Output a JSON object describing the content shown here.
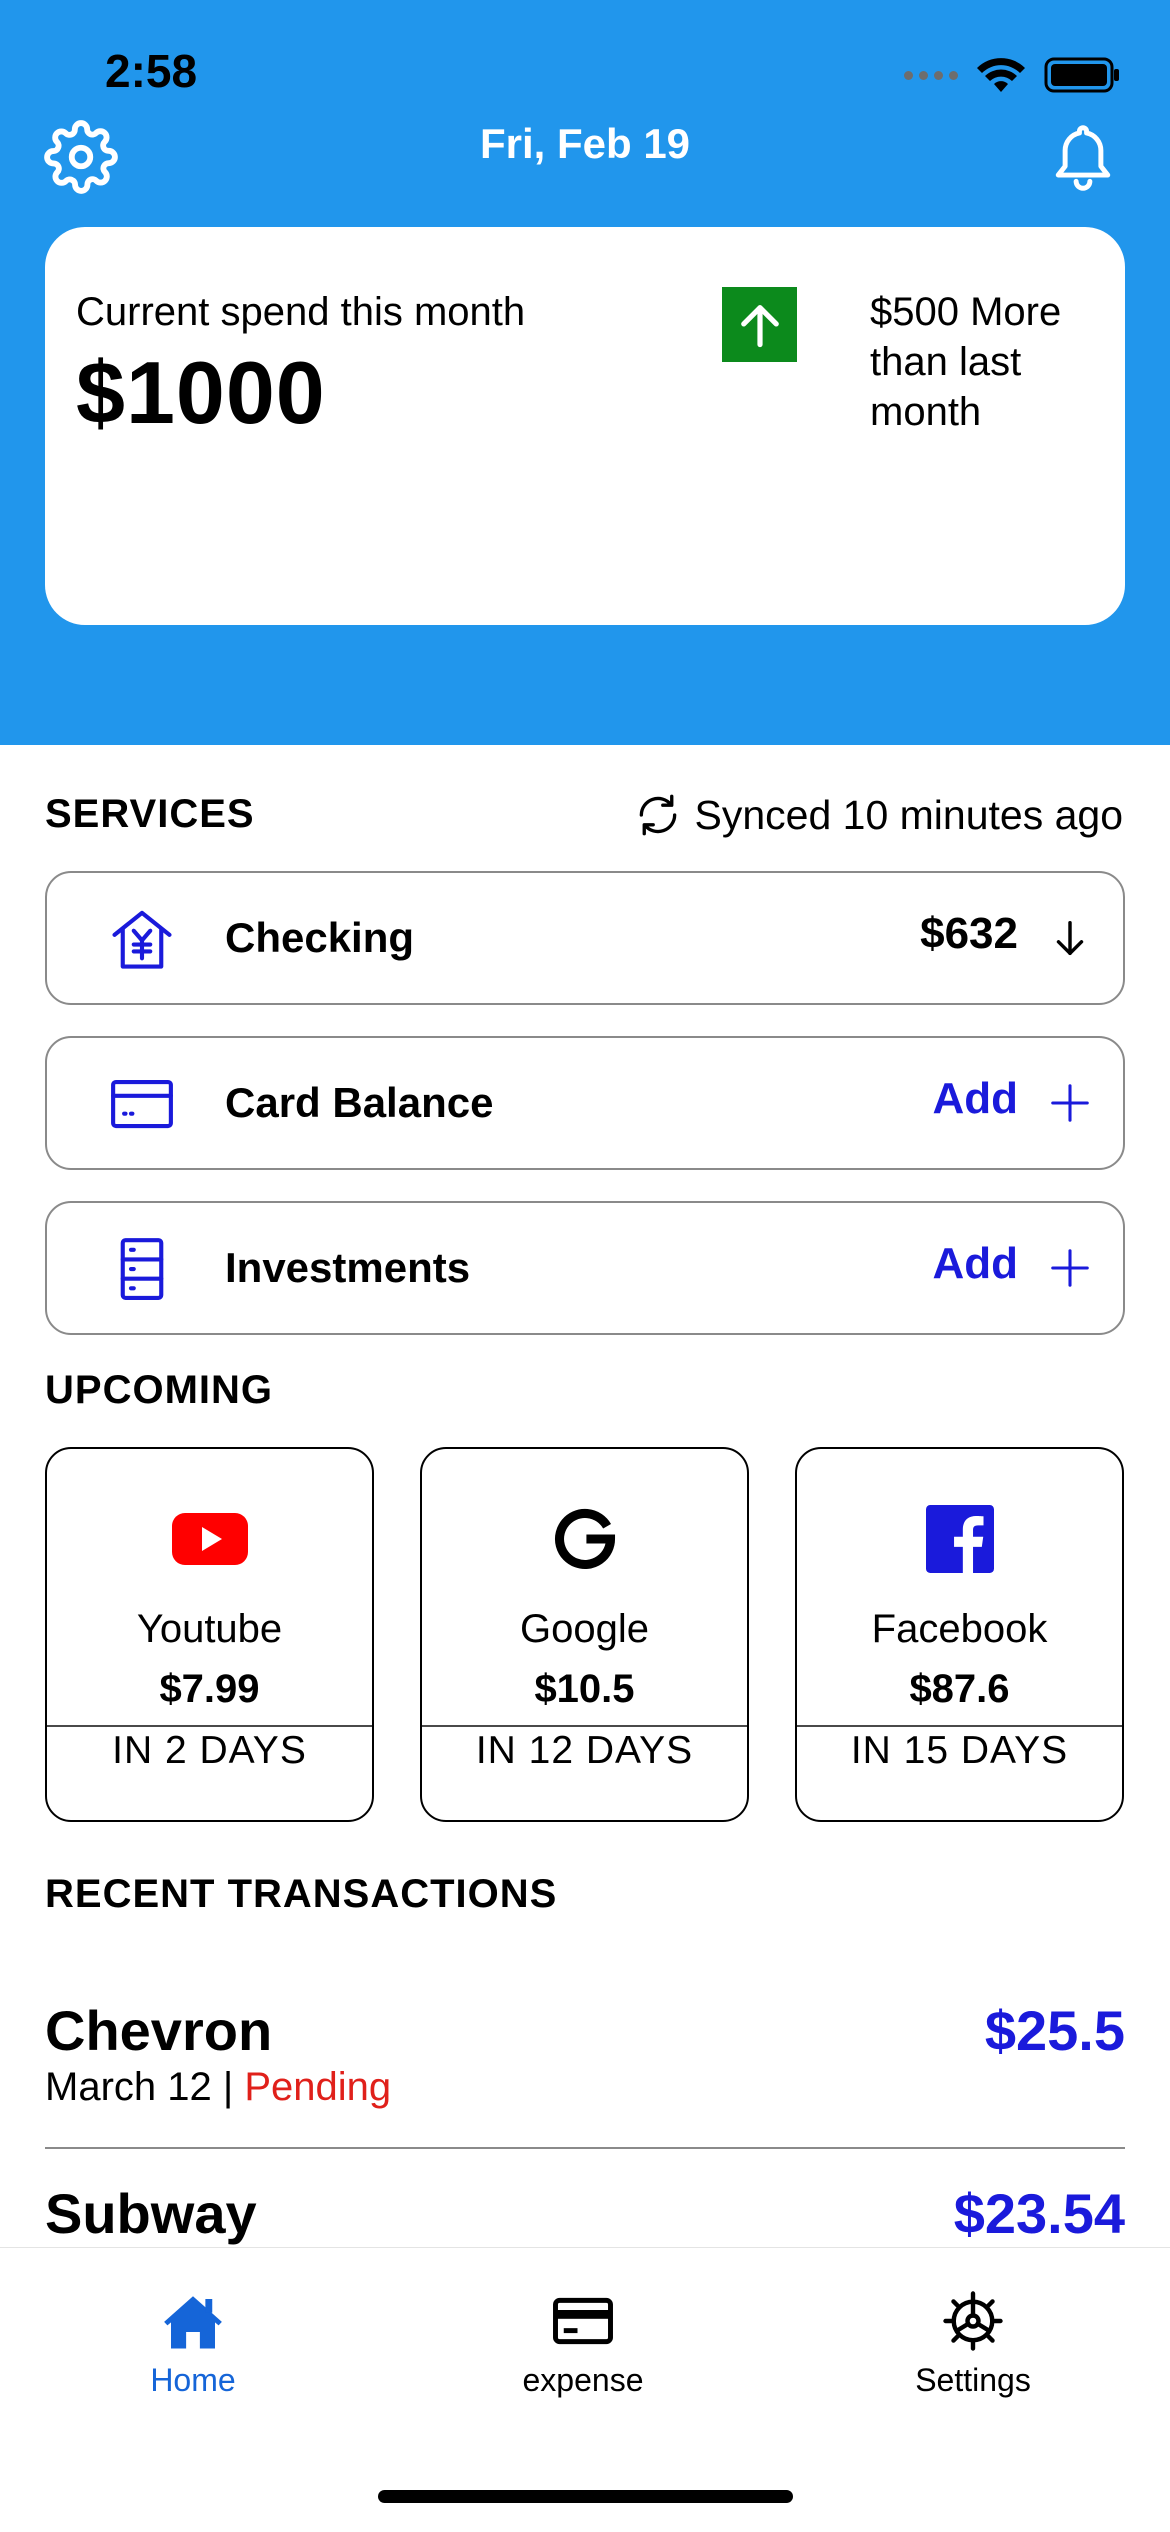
{
  "status_bar": {
    "time": "2:58"
  },
  "header": {
    "date": "Fri, Feb 19"
  },
  "spend_card": {
    "label": "Current spend this month",
    "amount": "$1000",
    "comparison": "$500 More than last month"
  },
  "services": {
    "title": "SERVICES",
    "sync_status": "Synced 10 minutes ago",
    "items": [
      {
        "label": "Checking",
        "value": "$632",
        "icon": "bank-yen-icon",
        "action_icon": "arrow-down-icon"
      },
      {
        "label": "Card Balance",
        "value": "Add",
        "icon": "credit-card-icon",
        "action_icon": "plus-icon"
      },
      {
        "label": "Investments",
        "value": "Add",
        "icon": "server-stack-icon",
        "action_icon": "plus-icon"
      }
    ]
  },
  "upcoming": {
    "title": "UPCOMING",
    "items": [
      {
        "name": "Youtube",
        "price": "$7.99",
        "due": "IN 2 DAYS",
        "icon": "youtube-icon"
      },
      {
        "name": "Google",
        "price": "$10.5",
        "due": "IN 12 DAYS",
        "icon": "google-icon"
      },
      {
        "name": "Facebook",
        "price": "$87.6",
        "due": "IN 15 DAYS",
        "icon": "facebook-icon"
      }
    ]
  },
  "recent_transactions": {
    "title": "RECENT TRANSACTIONS",
    "items": [
      {
        "name": "Chevron",
        "amount": "$25.5",
        "date": "March 12",
        "separator": " | ",
        "status": "Pending"
      },
      {
        "name": "Subway",
        "amount": "$23.54"
      }
    ]
  },
  "tabbar": {
    "items": [
      {
        "label": "Home",
        "icon": "home-icon",
        "active": true
      },
      {
        "label": "expense",
        "icon": "credit-card-icon",
        "active": false
      },
      {
        "label": "Settings",
        "icon": "gear-icon",
        "active": false
      }
    ]
  },
  "colors": {
    "header_blue": "#2196ec",
    "link_blue": "#1a1adb",
    "active_tab": "#1565d8",
    "increase_green": "#0c8a1c",
    "pending_red": "#e0201a"
  }
}
